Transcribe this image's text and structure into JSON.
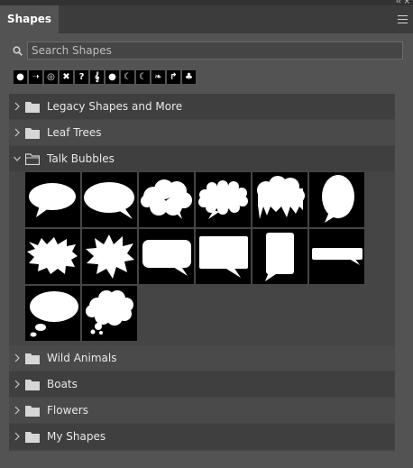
{
  "window": {
    "collapse_glyph": "‹‹",
    "close_glyph": "×"
  },
  "panel": {
    "title": "Shapes"
  },
  "search": {
    "placeholder": "Search Shapes",
    "value": ""
  },
  "presets": [
    {
      "icon": "speech-bubble-icon",
      "glyph": "●"
    },
    {
      "icon": "arrow-icon",
      "glyph": "➝"
    },
    {
      "icon": "spiral-icon",
      "glyph": "◎"
    },
    {
      "icon": "x-mark-icon",
      "glyph": "✖"
    },
    {
      "icon": "question-mark-icon",
      "glyph": "?"
    },
    {
      "icon": "treble-clef-icon",
      "glyph": "𝄞"
    },
    {
      "icon": "talk-bubble-icon",
      "glyph": "●"
    },
    {
      "icon": "crescent-moon-icon",
      "glyph": "☾"
    },
    {
      "icon": "moon-frame-icon",
      "glyph": "☾"
    },
    {
      "icon": "leaf-icon",
      "glyph": "❧"
    },
    {
      "icon": "signpost-icon",
      "glyph": "↱"
    },
    {
      "icon": "palm-tree-icon",
      "glyph": "♣"
    }
  ],
  "groups": [
    {
      "label": "Legacy Shapes and More",
      "expanded": false
    },
    {
      "label": "Leaf Trees",
      "expanded": false
    },
    {
      "label": "Talk Bubbles",
      "expanded": true
    },
    {
      "label": "Wild Animals",
      "expanded": false
    },
    {
      "label": "Boats",
      "expanded": false
    },
    {
      "label": "Flowers",
      "expanded": false
    },
    {
      "label": "My Shapes",
      "expanded": false
    }
  ],
  "talk_bubbles": [
    "oval-speech-bubble",
    "round-speech-bubble",
    "cloud-bubble",
    "scalloped-bubble",
    "dripping-bubble",
    "tall-oval-bubble",
    "spiky-burst-bubble",
    "star-burst-bubble",
    "rounded-rect-bubble",
    "square-rect-bubble",
    "tall-rect-bubble",
    "wide-bar-bubble",
    "thought-oval-bubble",
    "thought-cloud-bubble"
  ],
  "colors": {
    "panel_bg": "#535353",
    "list_bg": "#454545",
    "header_bg": "#3f3f3f",
    "thumb_bg": "#000000",
    "text": "#e8e8e8"
  }
}
